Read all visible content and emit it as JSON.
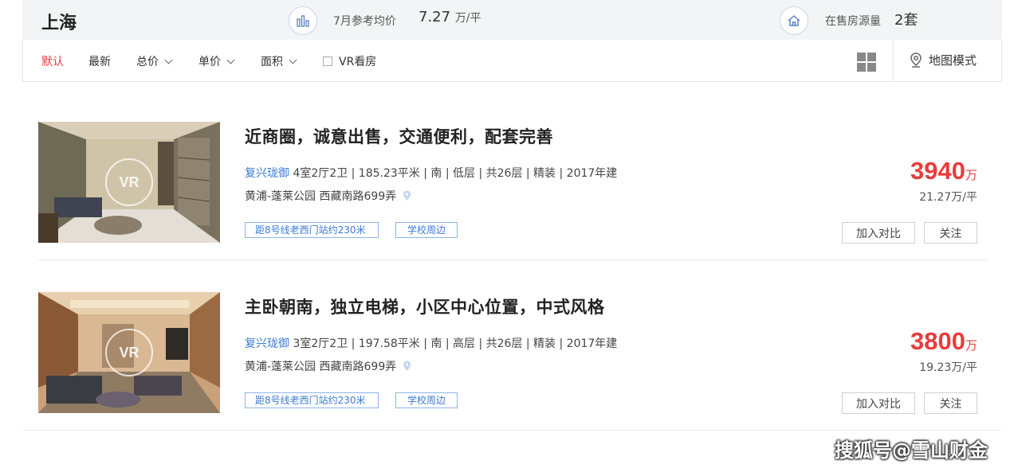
{
  "topbar": {
    "city": "上海",
    "avg_price_label": "7月参考均价",
    "avg_price_value": "7.27",
    "avg_price_unit": "万/平",
    "on_sale_label": "在售房源量",
    "on_sale_value": "2套"
  },
  "filters": {
    "default": "默认",
    "newest": "最新",
    "total_price": "总价",
    "unit_price": "单价",
    "area": "面积",
    "vr": "VR看房",
    "map_mode": "地图模式"
  },
  "listings": [
    {
      "title": "近商圈，诚意出售，交通便利，配套完善",
      "community": "复兴珑御",
      "details": "4室2厅2卫 | 185.23平米 | 南 | 低层 | 共26层 | 精装 | 2017年建",
      "address": "黄浦-蓬莱公园 西藏南路699弄",
      "tags": [
        "距8号线老西门站约230米",
        "学校周边"
      ],
      "price": "3940",
      "price_unit": "万",
      "unit_price": "21.27万/平",
      "compare_label": "加入对比",
      "follow_label": "关注",
      "vr_label": "VR"
    },
    {
      "title": "主卧朝南，独立电梯，小区中心位置，中式风格",
      "community": "复兴珑御",
      "details": "3室2厅2卫 | 197.58平米 | 南 | 高层 | 共26层 | 精装 | 2017年建",
      "address": "黄浦-蓬莱公园 西藏南路699弄",
      "tags": [
        "距8号线老西门站约230米",
        "学校周边"
      ],
      "price": "3800",
      "price_unit": "万",
      "unit_price": "19.23万/平",
      "compare_label": "加入对比",
      "follow_label": "关注",
      "vr_label": "VR"
    }
  ],
  "watermark": "搜狐号@雪山财金",
  "colors": {
    "accent_red": "#e93c3c",
    "link_blue": "#3b7bd4",
    "topbar_bg": "#f3f4f6"
  }
}
